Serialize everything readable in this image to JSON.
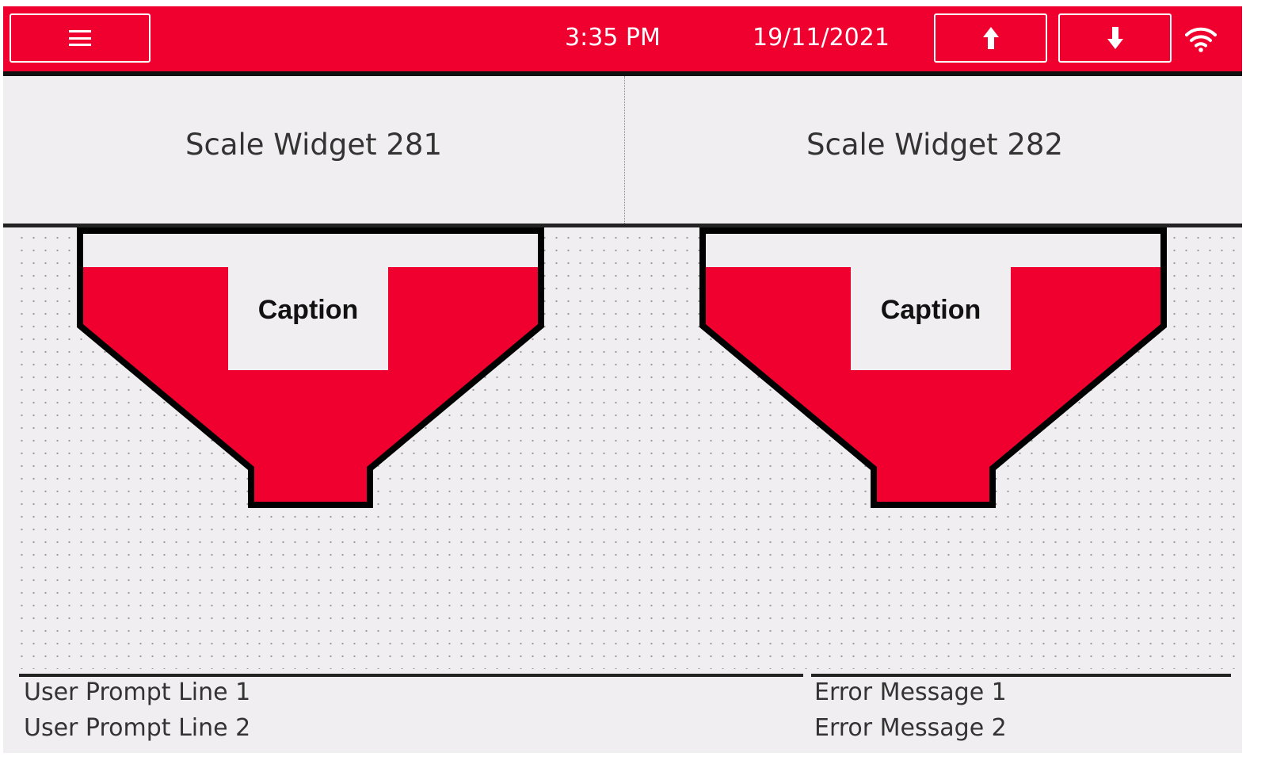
{
  "header": {
    "time": "3:35 PM",
    "date": "19/11/2021",
    "menu_icon": "hamburger-menu-icon",
    "up_icon": "arrow-up-icon",
    "down_icon": "arrow-down-icon",
    "wifi_icon": "wifi-icon",
    "accent_color": "#f0002e"
  },
  "widgets": [
    {
      "title": "Scale Widget 281",
      "caption": "Caption",
      "fill_color": "#f0002e"
    },
    {
      "title": "Scale Widget 282",
      "caption": "Caption",
      "fill_color": "#f0002e"
    }
  ],
  "footer": {
    "user_prompt_1": "User Prompt Line 1",
    "user_prompt_2": "User Prompt Line 2",
    "error_1": "Error Message 1",
    "error_2": "Error Message 2"
  }
}
